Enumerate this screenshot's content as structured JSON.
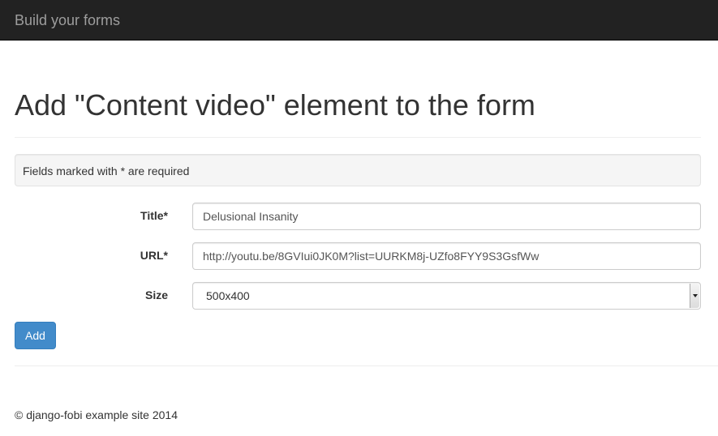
{
  "navbar": {
    "brand": "Build your forms"
  },
  "header": {
    "title": "Add \"Content video\" element to the form"
  },
  "notice": {
    "text": "Fields marked with * are required"
  },
  "form": {
    "title": {
      "label": "Title*",
      "value": "Delusional Insanity"
    },
    "url": {
      "label": "URL*",
      "value": "http://youtu.be/8GVIui0JK0M?list=UURKM8j-UZfo8FYY9S3GsfWw"
    },
    "size": {
      "label": "Size",
      "selected": "500x400"
    },
    "submit_label": "Add"
  },
  "footer": {
    "text": "© django-fobi example site 2014"
  },
  "colors": {
    "navbar_bg": "#222222",
    "brand_text": "#9d9d9d",
    "primary_button": "#428bca"
  }
}
